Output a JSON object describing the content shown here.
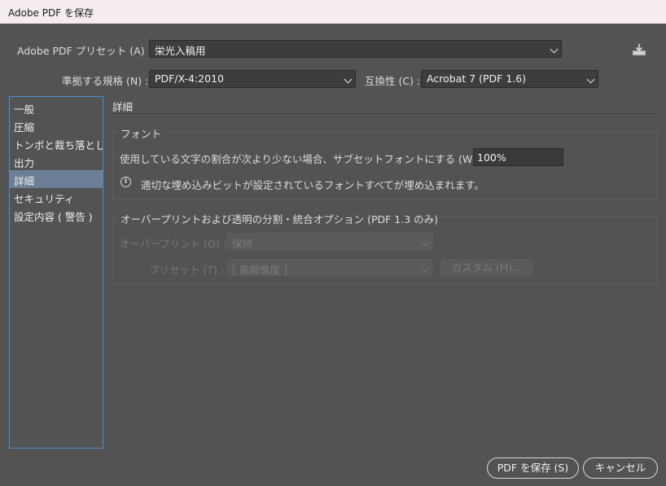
{
  "window": {
    "title": "Adobe PDF を保存"
  },
  "header": {
    "preset_label": "Adobe PDF プリセット (A) :",
    "preset_value": "栄光入稿用",
    "standard_label": "準拠する規格 (N) :",
    "standard_value": "PDF/X-4:2010",
    "compat_label": "互換性 (C) :",
    "compat_value": "Acrobat 7 (PDF 1.6)"
  },
  "sidebar": {
    "items": [
      {
        "label": "一般"
      },
      {
        "label": "圧縮"
      },
      {
        "label": "トンボと裁ち落とし"
      },
      {
        "label": "出力"
      },
      {
        "label": "詳細"
      },
      {
        "label": "セキュリティ"
      },
      {
        "label": "設定内容 ( 警告 )"
      }
    ],
    "selected": "詳細"
  },
  "main": {
    "section_title": "詳細",
    "fonts": {
      "group_title": "フォント",
      "subset_label": "使用している文字の割合が次より少ない場合、サブセットフォントにする (W) :",
      "subset_value": "100%",
      "info_text": "適切な埋め込みビットが設定されているフォントすべてが埋め込まれます。"
    },
    "overprint": {
      "group_title": "オーバープリントおよび透明の分割・統合オプション (PDF 1.3 のみ)",
      "overprint_label": "オーバープリント (O) :",
      "overprint_value": "保持",
      "preset_label": "プリセット (T) :",
      "preset_value": "[ 高解像度 ]",
      "custom_label": "カスタム (M)..."
    }
  },
  "footer": {
    "save_label": "PDF を保存 (S)",
    "cancel_label": "キャンセル"
  }
}
